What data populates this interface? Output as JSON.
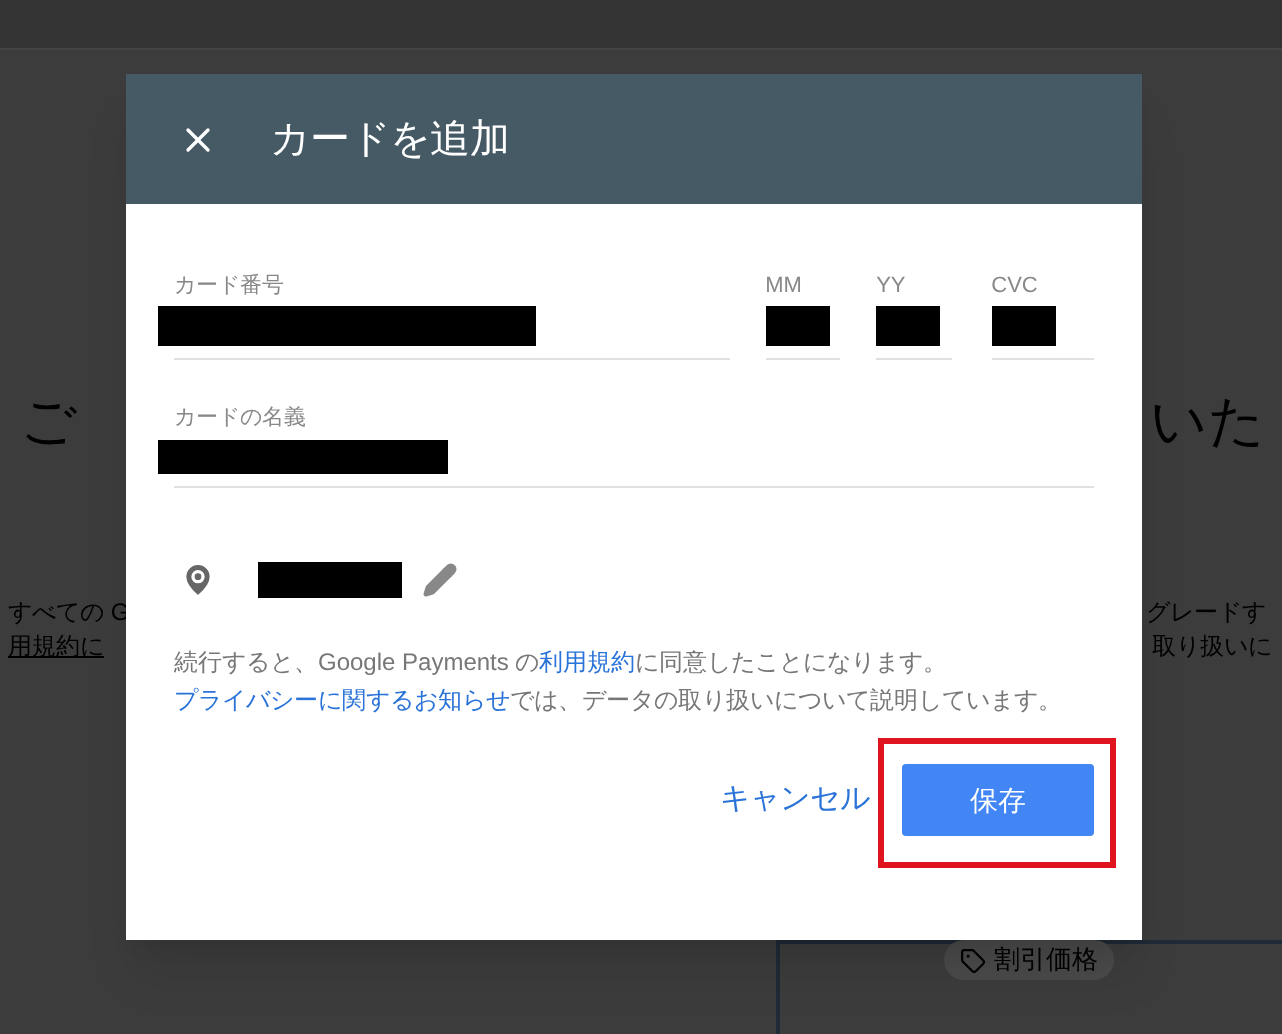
{
  "background": {
    "texts": [
      "ご",
      "いた",
      "すべての G",
      "用規約に",
      "グレードす",
      "取り扱いに"
    ],
    "tag": "割引価格"
  },
  "dialog": {
    "title": "カードを追加",
    "fields": [
      {
        "label": "カード番号",
        "kind": "wide"
      },
      {
        "label": "MM",
        "kind": "short"
      },
      {
        "label": "YY",
        "kind": "short"
      },
      {
        "label": "CVC",
        "kind": "short"
      }
    ],
    "name_field": {
      "label": "カードの名義"
    },
    "notice": "続行すると、Google Payments の",
    "terms_link": "利用規約",
    "notice_mid": "に同意したことになります。",
    "privacy_link": "プライバシーに関するお知らせ",
    "notice_end": "では、データの取り扱いについて説明しています。",
    "cancel": "キャンセル",
    "save": "保存",
    "save_highlighted": true
  }
}
